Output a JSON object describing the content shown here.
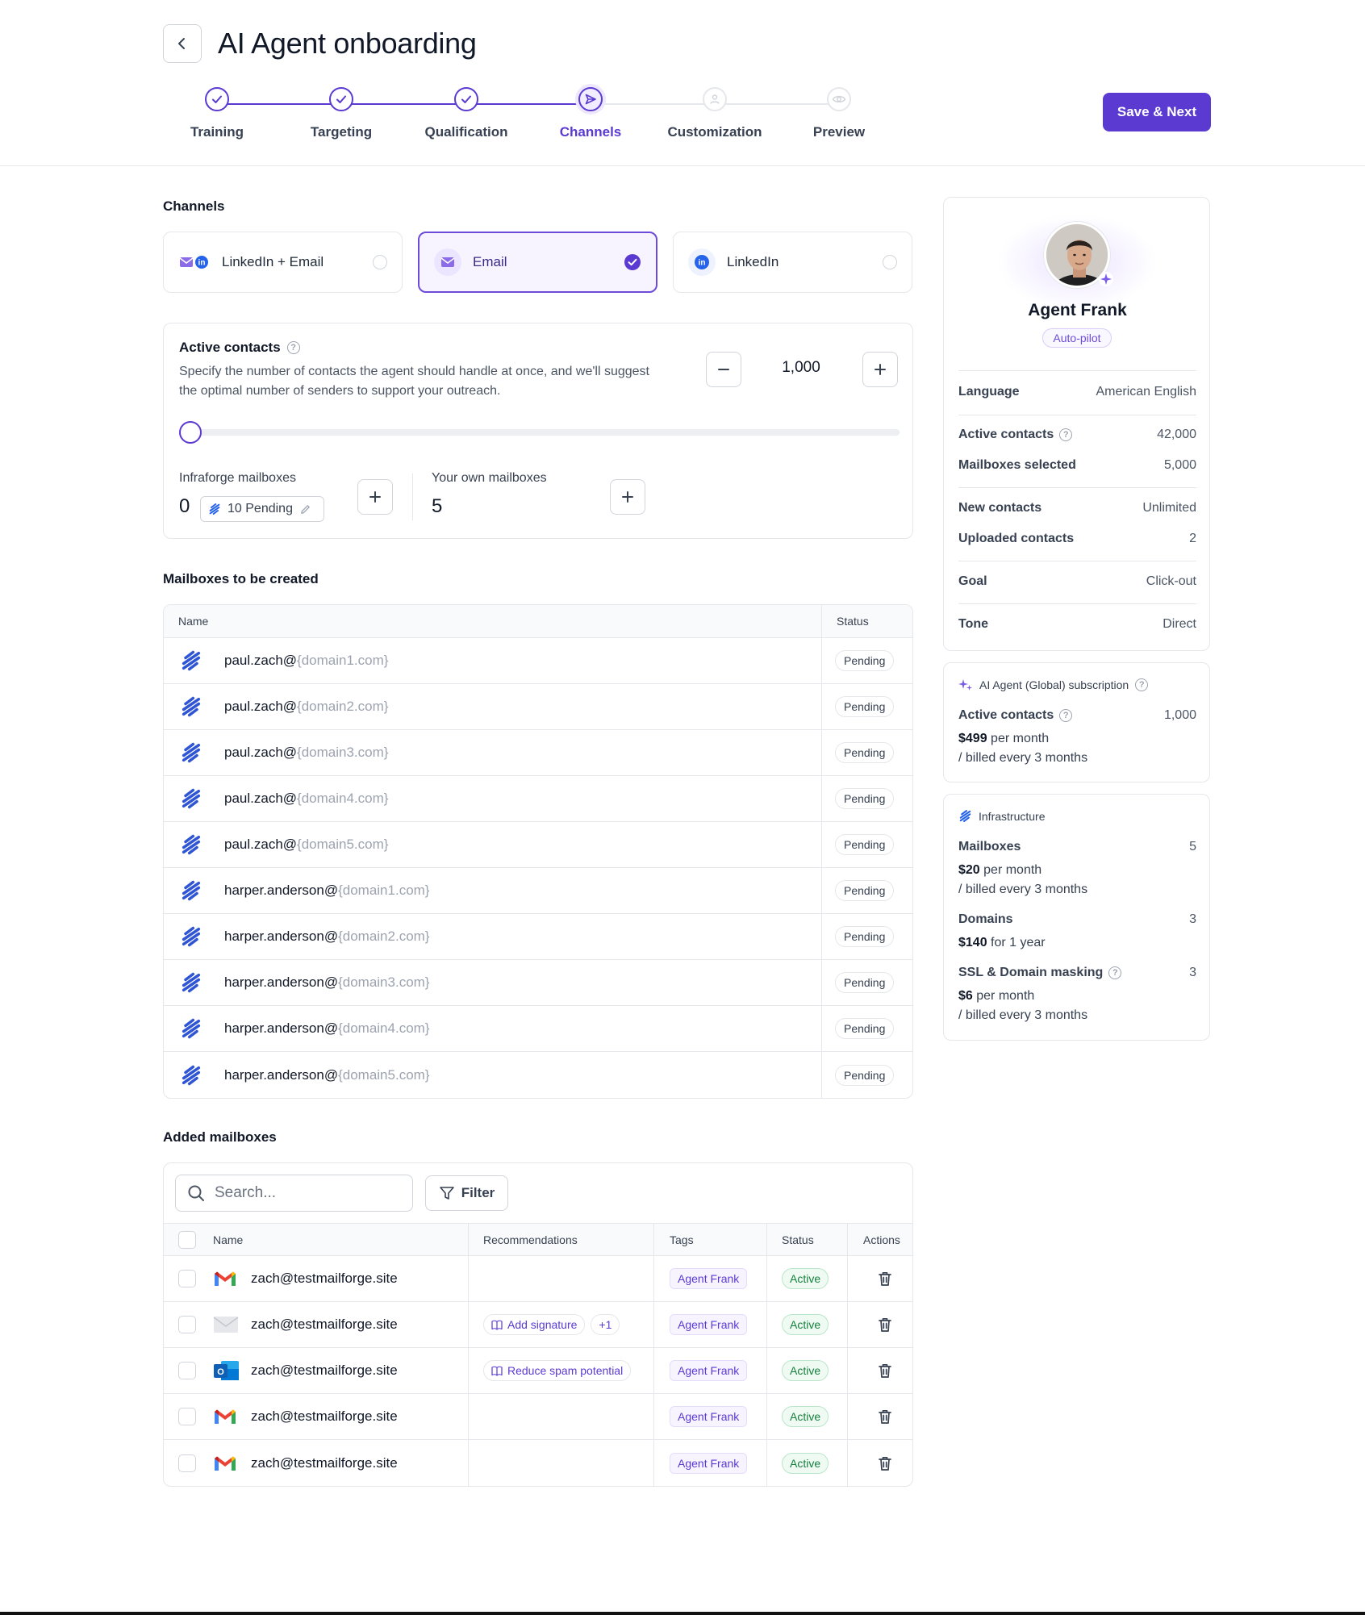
{
  "header": {
    "title": "AI Agent onboarding",
    "save_label": "Save & Next",
    "steps": [
      {
        "label": "Training",
        "state": "done"
      },
      {
        "label": "Targeting",
        "state": "done"
      },
      {
        "label": "Qualification",
        "state": "done"
      },
      {
        "label": "Channels",
        "state": "current"
      },
      {
        "label": "Customization",
        "state": "todo"
      },
      {
        "label": "Preview",
        "state": "todo"
      }
    ]
  },
  "channels": {
    "title": "Channels",
    "options": [
      {
        "label": "LinkedIn + Email",
        "selected": false
      },
      {
        "label": "Email",
        "selected": true
      },
      {
        "label": "LinkedIn",
        "selected": false
      }
    ]
  },
  "active_contacts": {
    "title": "Active contacts",
    "description": "Specify the number of contacts the agent should handle at once, and we'll suggest the optimal number of senders to support your outreach.",
    "value": "1,000",
    "slider_fraction": 0,
    "infraforge_label": "Infraforge mailboxes",
    "infraforge_value": "0",
    "pending_label": "10 Pending",
    "own_label": "Your own mailboxes",
    "own_value": "5"
  },
  "mailboxes_to_create": {
    "title": "Mailboxes to be created",
    "col_name": "Name",
    "col_status": "Status",
    "rows": [
      {
        "local": "paul.zach@",
        "domain": "{domain1.com}",
        "status": "Pending"
      },
      {
        "local": "paul.zach@",
        "domain": "{domain2.com}",
        "status": "Pending"
      },
      {
        "local": "paul.zach@",
        "domain": "{domain3.com}",
        "status": "Pending"
      },
      {
        "local": "paul.zach@",
        "domain": "{domain4.com}",
        "status": "Pending"
      },
      {
        "local": "paul.zach@",
        "domain": "{domain5.com}",
        "status": "Pending"
      },
      {
        "local": "harper.anderson@",
        "domain": "{domain1.com}",
        "status": "Pending"
      },
      {
        "local": "harper.anderson@",
        "domain": "{domain2.com}",
        "status": "Pending"
      },
      {
        "local": "harper.anderson@",
        "domain": "{domain3.com}",
        "status": "Pending"
      },
      {
        "local": "harper.anderson@",
        "domain": "{domain4.com}",
        "status": "Pending"
      },
      {
        "local": "harper.anderson@",
        "domain": "{domain5.com}",
        "status": "Pending"
      }
    ]
  },
  "added_mailboxes": {
    "title": "Added mailboxes",
    "search_placeholder": "Search...",
    "filter_label": "Filter",
    "columns": {
      "name": "Name",
      "recommendations": "Recommendations",
      "tags": "Tags",
      "status": "Status",
      "actions": "Actions"
    },
    "rows": [
      {
        "provider": "gmail",
        "email": "zach@testmailforge.site",
        "recs": [],
        "tag": "Agent Frank",
        "status": "Active"
      },
      {
        "provider": "generic-mail",
        "email": "zach@testmailforge.site",
        "recs": [
          "Add signature",
          "+1"
        ],
        "tag": "Agent Frank",
        "status": "Active"
      },
      {
        "provider": "outlook",
        "email": "zach@testmailforge.site",
        "recs": [
          "Reduce spam potential"
        ],
        "tag": "Agent Frank",
        "status": "Active"
      },
      {
        "provider": "gmail",
        "email": "zach@testmailforge.site",
        "recs": [],
        "tag": "Agent Frank",
        "status": "Active"
      },
      {
        "provider": "gmail",
        "email": "zach@testmailforge.site",
        "recs": [],
        "tag": "Agent Frank",
        "status": "Active"
      }
    ]
  },
  "agent_panel": {
    "name": "Agent Frank",
    "mode": "Auto-pilot",
    "language_label": "Language",
    "language_value": "American English",
    "active_contacts_label": "Active contacts",
    "active_contacts_value": "42,000",
    "mailboxes_selected_label": "Mailboxes selected",
    "mailboxes_selected_value": "5,000",
    "new_contacts_label": "New contacts",
    "new_contacts_value": "Unlimited",
    "uploaded_contacts_label": "Uploaded contacts",
    "uploaded_contacts_value": "2",
    "goal_label": "Goal",
    "goal_value": "Click-out",
    "tone_label": "Tone",
    "tone_value": "Direct"
  },
  "subscription": {
    "title": "AI Agent (Global) subscription",
    "active_contacts_label": "Active contacts",
    "active_contacts_value": "1,000",
    "price": "$499",
    "price_unit": "per month",
    "billing": "/ billed every 3 months"
  },
  "infrastructure": {
    "title": "Infrastructure",
    "mailboxes_label": "Mailboxes",
    "mailboxes_value": "5",
    "mailboxes_price": "$20",
    "mailboxes_unit": "per month",
    "mailboxes_billing": "/ billed every 3 months",
    "domains_label": "Domains",
    "domains_value": "3",
    "domains_price": "$140",
    "domains_unit": "for 1 year",
    "ssl_label": "SSL & Domain masking",
    "ssl_value": "3",
    "ssl_price": "$6",
    "ssl_unit": "per month",
    "ssl_billing": "/ billed every 3 months"
  },
  "colors": {
    "accent": "#5b3ad1",
    "success": "#15803d",
    "border": "#e5e7eb"
  }
}
